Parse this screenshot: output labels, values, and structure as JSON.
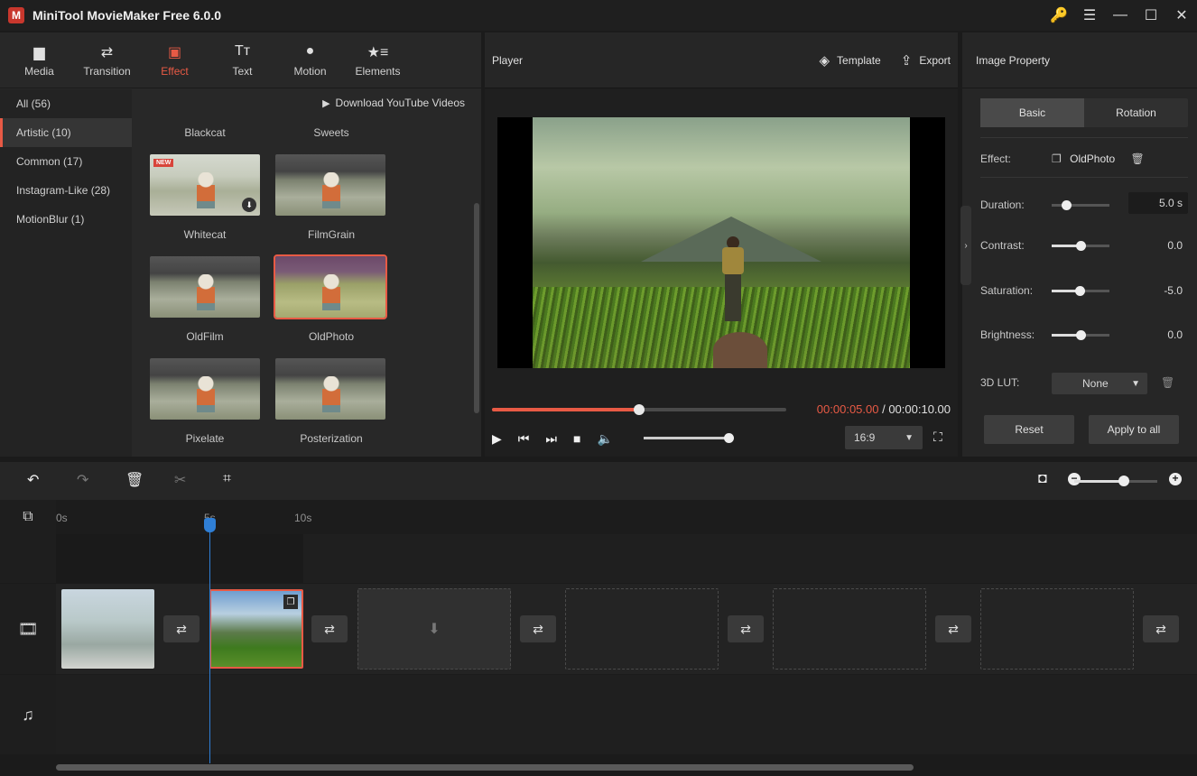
{
  "window": {
    "title": "MiniTool MovieMaker Free 6.0.0",
    "logo": "M"
  },
  "window_controls": [
    {
      "name": "key-icon",
      "glyph": "🔑"
    },
    {
      "name": "menu-icon",
      "glyph": "☰"
    },
    {
      "name": "minimize-icon",
      "glyph": "—"
    },
    {
      "name": "maximize-icon",
      "glyph": "☐"
    },
    {
      "name": "close-icon",
      "glyph": "✕"
    }
  ],
  "library": {
    "tabs": [
      {
        "label": "Media",
        "icon": "folder-icon",
        "glyph": "▆"
      },
      {
        "label": "Transition",
        "icon": "transition-icon",
        "glyph": "⇄"
      },
      {
        "label": "Effect",
        "icon": "effect-icon",
        "glyph": "▣"
      },
      {
        "label": "Text",
        "icon": "text-icon",
        "glyph": "Tт"
      },
      {
        "label": "Motion",
        "icon": "motion-icon",
        "glyph": "●"
      },
      {
        "label": "Elements",
        "icon": "elements-icon",
        "glyph": "★≡"
      }
    ],
    "active_tab": "Effect",
    "categories": [
      {
        "label": "All (56)"
      },
      {
        "label": "Artistic (10)"
      },
      {
        "label": "Common (17)"
      },
      {
        "label": "Instagram-Like (28)"
      },
      {
        "label": "MotionBlur (1)"
      }
    ],
    "active_category": "Artistic (10)",
    "download_link": "Download YouTube Videos",
    "effects": [
      {
        "label": "Blackcat"
      },
      {
        "label": "Sweets"
      },
      {
        "label": "Whitecat",
        "badge": "NEW"
      },
      {
        "label": "FilmGrain"
      },
      {
        "label": "OldFilm"
      },
      {
        "label": "OldPhoto"
      },
      {
        "label": "Pixelate"
      },
      {
        "label": "Posterization"
      }
    ],
    "selected_effect": "OldPhoto"
  },
  "player": {
    "title": "Player",
    "template_label": "Template",
    "export_label": "Export",
    "current_time": "00:00:05.00",
    "total_time": " / 00:00:10.00",
    "progress": 0.5,
    "volume": 1.0,
    "aspect_ratio": "16:9"
  },
  "properties": {
    "title": "Image Property",
    "tabs": [
      "Basic",
      "Rotation"
    ],
    "effect_label": "Effect:",
    "effect_value": "OldPhoto",
    "duration_label": "Duration:",
    "duration_value": "5.0 s",
    "duration_level": 0.25,
    "contrast_label": "Contrast:",
    "contrast_value": "0.0",
    "contrast_level": 0.5,
    "saturation_label": "Saturation:",
    "saturation_value": "-5.0",
    "saturation_level": 0.48,
    "brightness_label": "Brightness:",
    "brightness_value": "0.0",
    "brightness_level": 0.5,
    "lut_label": "3D LUT:",
    "lut_value": "None",
    "reset_label": "Reset",
    "apply_label": "Apply to all"
  },
  "timeline": {
    "ruler": [
      "0s",
      "5s",
      "10s"
    ],
    "zoom_level": 0.6
  },
  "colors": {
    "accent": "#e85a45",
    "playhead": "#2f7fd6"
  }
}
